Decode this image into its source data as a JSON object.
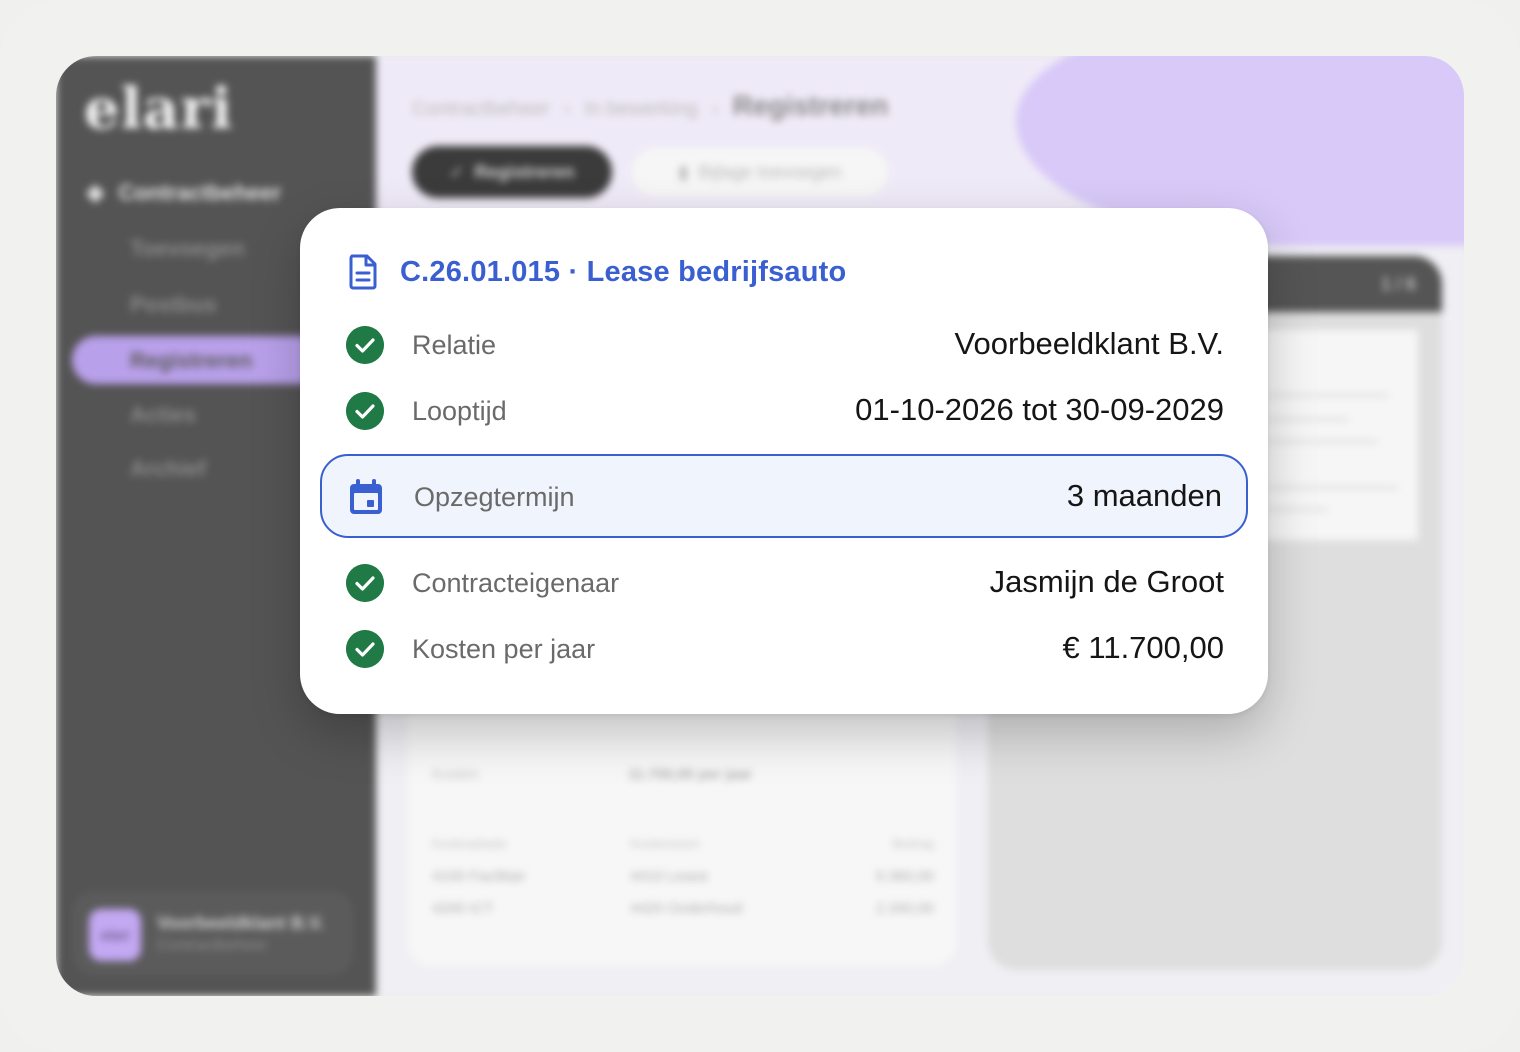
{
  "brand": {
    "logo_text": "elari"
  },
  "sidebar": {
    "section_title": "Contractbeheer",
    "items": [
      {
        "label": "Toevoegen"
      },
      {
        "label": "Postbus"
      },
      {
        "label": "Registreren",
        "active": true
      },
      {
        "label": "Acties"
      },
      {
        "label": "Archief"
      }
    ],
    "account": {
      "logo_text": "elari",
      "name": "Voorbeeldklant B.V.",
      "subtitle": "Contractbeheer"
    }
  },
  "breadcrumb": {
    "items": [
      "Contractbeheer",
      "In bewerking"
    ],
    "separator": "›",
    "current": "Registreren"
  },
  "toolbar": {
    "primary_label": "Registreren",
    "secondary_label": "Bijlage toevoegen"
  },
  "background_panel": {
    "cost_label": "Kosten",
    "cost_value": "11.700,00 per jaar",
    "table_headers": [
      "Kostenplaats",
      "Kostensoort",
      "Bedrag"
    ],
    "table_rows": [
      [
        "4100 Facilitair",
        "4410 Lease",
        "9.360,00"
      ],
      [
        "4200 ICT",
        "4420 Onderhoud",
        "2.340,00"
      ]
    ]
  },
  "preview": {
    "page_indicator": "1 / 6"
  },
  "card": {
    "title": "C.26.01.015 · Lease bedrijfsauto",
    "fields": [
      {
        "label": "Relatie",
        "value": "Voorbeeldklant B.V.",
        "status": "check"
      },
      {
        "label": "Looptijd",
        "value": "01-10-2026 tot 30-09-2029",
        "status": "check"
      },
      {
        "label": "Opzegtermijn",
        "value": "3 maanden",
        "status": "calendar",
        "highlighted": true
      },
      {
        "label": "Contracteigenaar",
        "value": "Jasmijn de Groot",
        "status": "check"
      },
      {
        "label": "Kosten per jaar",
        "value": "€ 11.700,00",
        "status": "check"
      }
    ]
  },
  "colors": {
    "accent_blue": "#3a5fd0",
    "check_green": "#1f7a46",
    "sidebar_bg": "#545454",
    "highlight_bg": "#f0f4fd",
    "purple_accent": "#d8c9f8"
  }
}
